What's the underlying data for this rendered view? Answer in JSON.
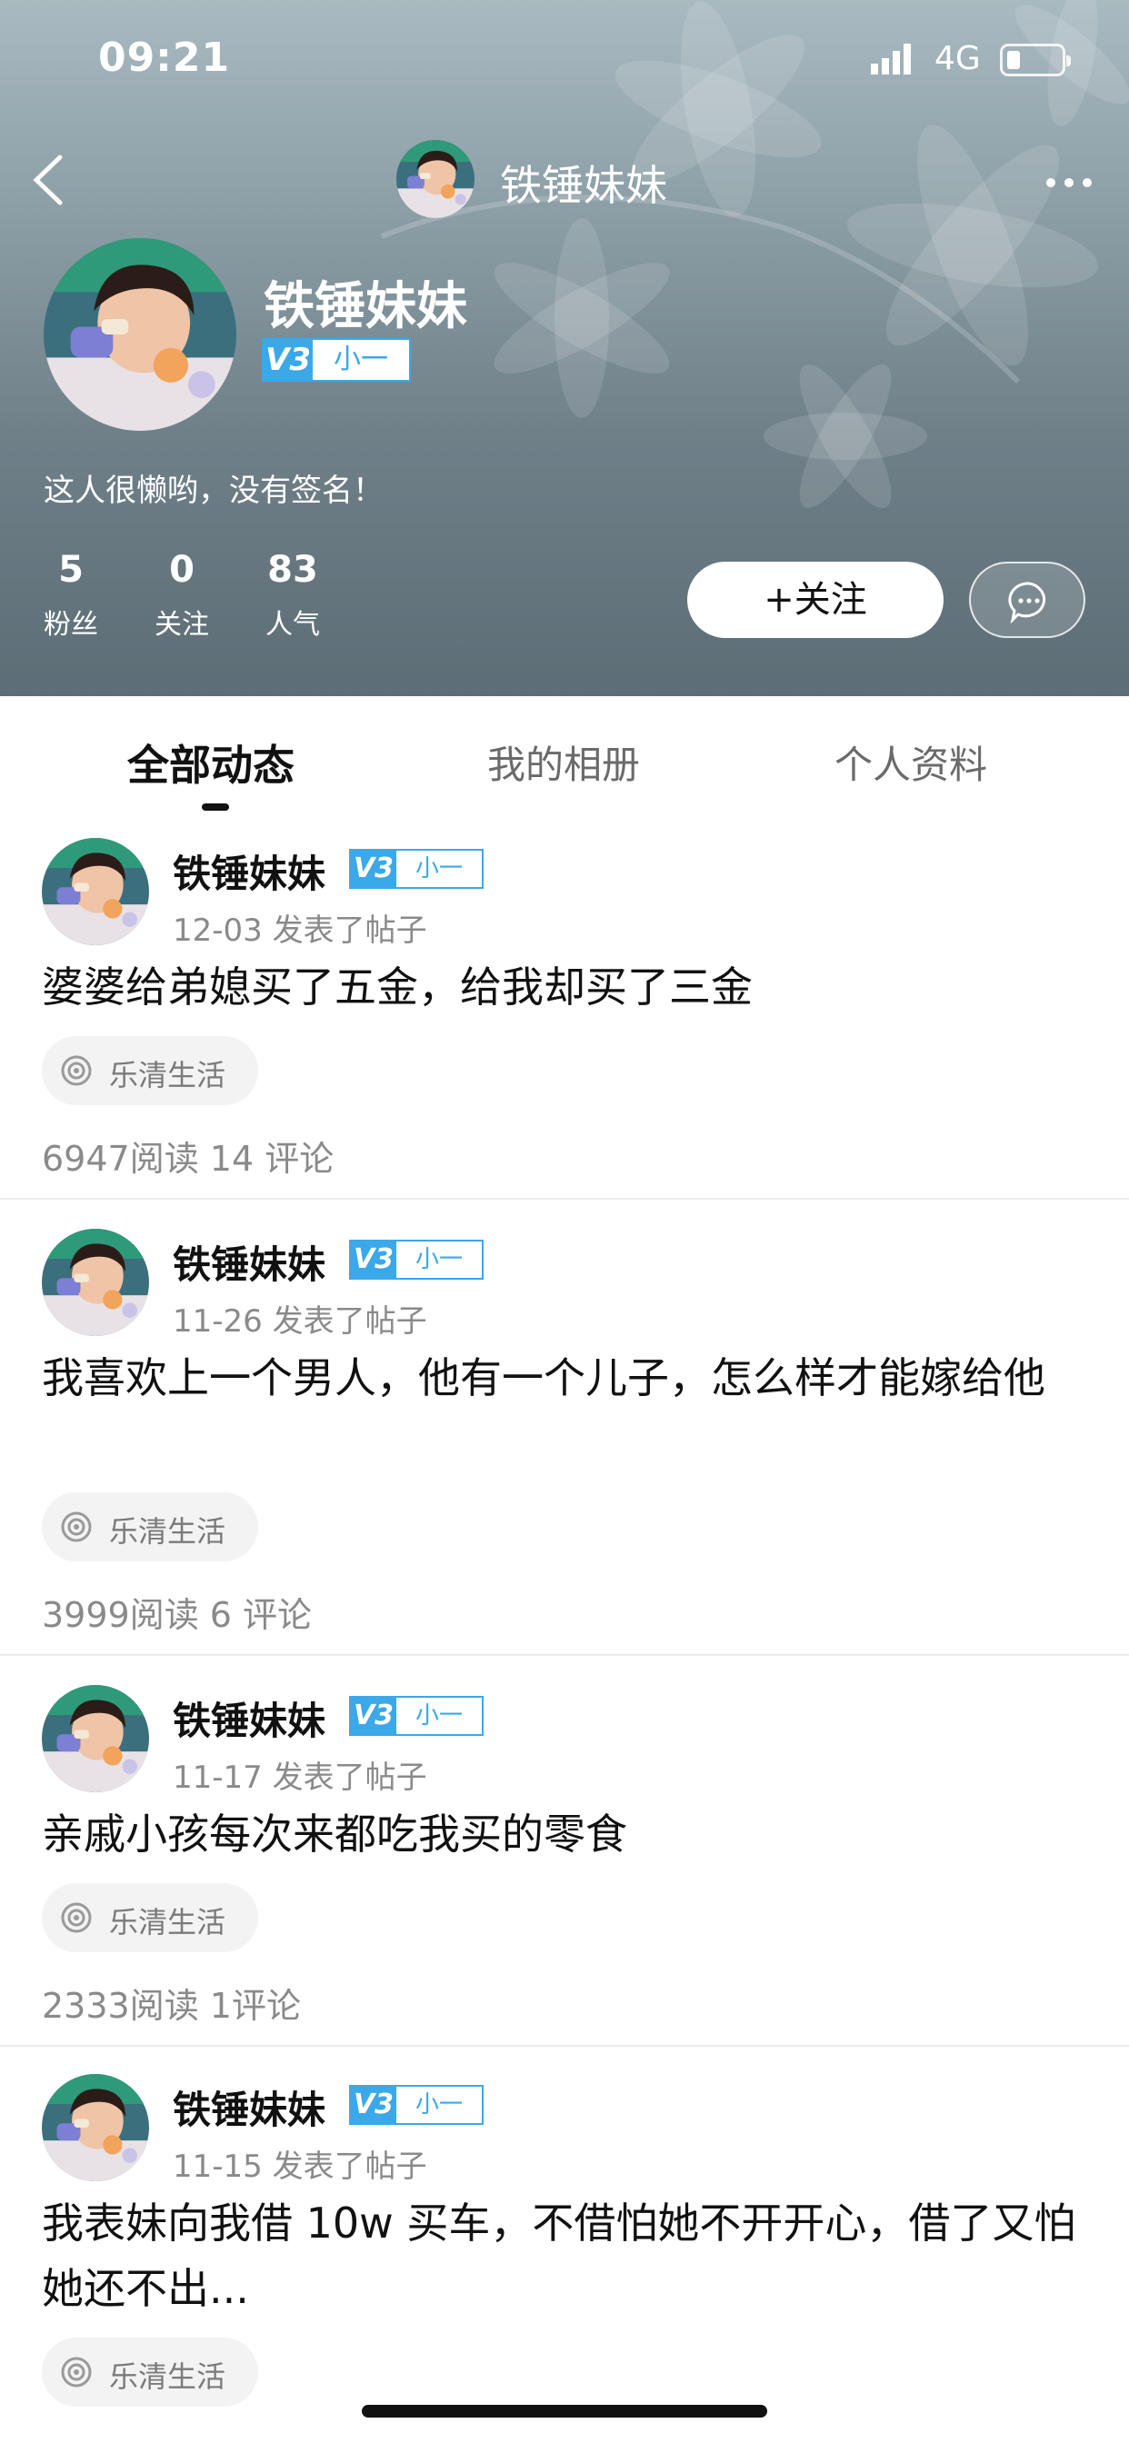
{
  "status_bar": {
    "time": "09:21",
    "network": "4G",
    "signal_icon": "signal-bars-icon",
    "battery_icon": "battery-low-icon"
  },
  "nav": {
    "title": "铁锤妹妹",
    "back_icon": "chevron-left-icon",
    "more_icon": "more-dots-icon"
  },
  "profile": {
    "name": "铁锤妹妹",
    "badge_v": "V3",
    "badge_level": "小一",
    "bio": "这人很懒哟，没有签名！",
    "stats": [
      {
        "value": "5",
        "label": "粉丝"
      },
      {
        "value": "0",
        "label": "关注"
      },
      {
        "value": "83",
        "label": "人气"
      }
    ],
    "follow_label": "+关注",
    "chat_icon": "chat-bubble-icon"
  },
  "tabs": [
    {
      "label": "全部动态",
      "active": true
    },
    {
      "label": "我的相册",
      "active": false
    },
    {
      "label": "个人资料",
      "active": false
    }
  ],
  "posts": [
    {
      "author": "铁锤妹妹",
      "badge_v": "V3",
      "badge_level": "小一",
      "time": "12-03 发表了帖子",
      "text": "婆婆给弟媳买了五金，给我却买了三金",
      "topic": "乐清生活",
      "stats": "6947阅读  14 评论"
    },
    {
      "author": "铁锤妹妹",
      "badge_v": "V3",
      "badge_level": "小一",
      "time": "11-26 发表了帖子",
      "text": "我喜欢上一个男人，他有一个儿子，怎么样才能嫁给他",
      "topic": "乐清生活",
      "stats": "3999阅读  6 评论"
    },
    {
      "author": "铁锤妹妹",
      "badge_v": "V3",
      "badge_level": "小一",
      "time": "11-17 发表了帖子",
      "text": "亲戚小孩每次来都吃我买的零食",
      "topic": "乐清生活",
      "stats": "2333阅读  1评论"
    },
    {
      "author": "铁锤妹妹",
      "badge_v": "V3",
      "badge_level": "小一",
      "time": "11-15 发表了帖子",
      "text": "我表妹向我借 10w 买车，不借怕她不开开心，借了又怕她还不出...",
      "topic": "乐清生活",
      "stats": ""
    }
  ],
  "colors": {
    "accent_blue": "#3aa8e9",
    "header_bg": "#7a8b93"
  }
}
